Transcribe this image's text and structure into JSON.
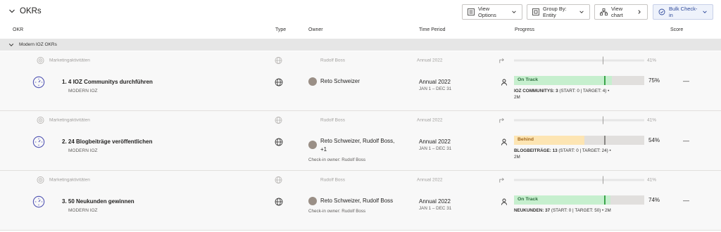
{
  "header": {
    "title": "OKRs",
    "view_options": "View Options",
    "group_by": "Group By: Entity",
    "view_chart": "View chart",
    "bulk_checkin": "Bulk Check-in"
  },
  "columns": {
    "okr": "OKR",
    "type": "Type",
    "owner": "Owner",
    "time_period": "Time Period",
    "progress": "Progress",
    "score": "Score"
  },
  "group": {
    "label": "Modern IOZ OKRs"
  },
  "rows": [
    {
      "parent": {
        "title": "Marketingaktivitäten",
        "owner": "Rudolf Boss",
        "period": "Annual 2022",
        "progress_pct": "41%",
        "progress_value": 0.41
      },
      "title": "1. 4 IOZ Communitys durchführen",
      "entity": "MODERN IOZ",
      "owner": "Reto Schweizer",
      "checkin_owner": "",
      "period": "Annual 2022",
      "period_range": "JAN 1 – DEC 31",
      "status": "On Track",
      "progress_value": 0.75,
      "progress_pct": "75%",
      "metric_name": "IOZ COMMUNITYS: 3",
      "metric_detail": "(START: 0 | TARGET: 4) •",
      "metric_extra": "2M",
      "score": "—"
    },
    {
      "parent": {
        "title": "Marketingaktivitäten",
        "owner": "Rudolf Boss",
        "period": "Annual 2022",
        "progress_pct": "41%",
        "progress_value": 0.41
      },
      "title": "2. 24 Blogbeiträge veröffentlichen",
      "entity": "MODERN IOZ",
      "owner": "Reto Schweizer, Rudolf Boss,",
      "owner_more": "+1",
      "checkin_owner": "Check-in owner: Rudolf Boss",
      "period": "Annual 2022",
      "period_range": "JAN 1 – DEC 31",
      "status": "Behind",
      "progress_value": 0.54,
      "progress_pct": "54%",
      "metric_name": "BLOGBEITRÄGE: 13",
      "metric_detail": "(START: 0 | TARGET: 24) •",
      "metric_extra": "2M",
      "score": "—"
    },
    {
      "parent": {
        "title": "Marketingaktivitäten",
        "owner": "Rudolf Boss",
        "period": "Annual 2022",
        "progress_pct": "41%",
        "progress_value": 0.41
      },
      "title": "3. 50 Neukunden gewinnen",
      "entity": "MODERN IOZ",
      "owner": "Reto Schweizer, Rudolf Boss",
      "checkin_owner": "Check-in owner: Rudolf Boss",
      "period": "Annual 2022",
      "period_range": "JAN 1 – DEC 31",
      "status": "On Track",
      "progress_value": 0.74,
      "progress_pct": "74%",
      "metric_name": "NEUKUNDEN: 37",
      "metric_detail": "(START: 0 | TARGET: 50) • 2M",
      "metric_extra": "",
      "score": "—"
    }
  ],
  "colors": {
    "on_track": "#c6efce",
    "behind": "#fde5b3",
    "track": "#e1dfdd",
    "accent": "#2f4a9b"
  },
  "icons": [
    "chevron-down-icon",
    "list-icon",
    "group-icon",
    "chart-icon",
    "chevron-right-icon",
    "refresh-icon",
    "goal-icon",
    "gauge-icon",
    "globe-icon",
    "person-icon",
    "arrow-turn-icon"
  ]
}
